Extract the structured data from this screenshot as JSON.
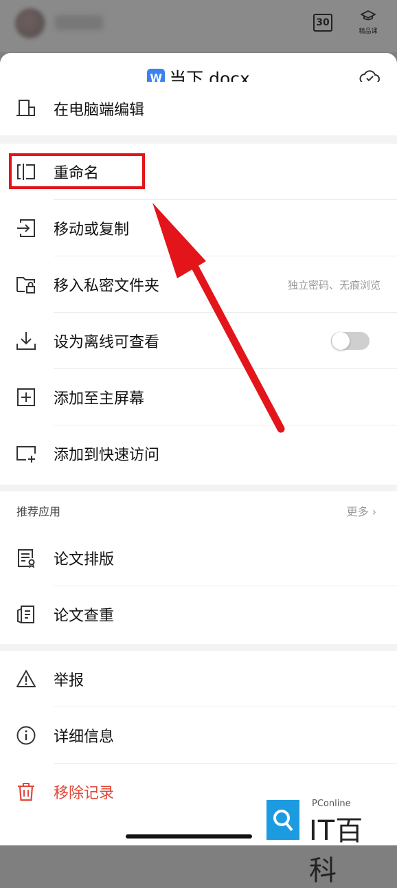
{
  "topbar": {
    "calendar_number": "30",
    "course_label": "精品课"
  },
  "sheet": {
    "doc_icon_letter": "W",
    "title": "当下.docx"
  },
  "menu_group_1": [
    {
      "label": "在电脑端编辑",
      "icon": "desktop-edit-icon"
    }
  ],
  "menu_group_2": [
    {
      "label": "重命名",
      "icon": "rename-icon"
    },
    {
      "label": "移动或复制",
      "icon": "move-icon"
    },
    {
      "label": "移入私密文件夹",
      "icon": "private-folder-icon",
      "hint": "独立密码、无痕浏览"
    },
    {
      "label": "设为离线可查看",
      "icon": "download-icon",
      "toggle_on": false
    },
    {
      "label": "添加至主屏幕",
      "icon": "add-square-icon"
    },
    {
      "label": "添加到快速访问",
      "icon": "quick-access-icon"
    }
  ],
  "recommended": {
    "title": "推荐应用",
    "more": "更多 ›",
    "items": [
      {
        "label": "论文排版",
        "icon": "paper-layout-icon"
      },
      {
        "label": "论文查重",
        "icon": "paper-check-icon"
      }
    ]
  },
  "menu_group_3": [
    {
      "label": "举报",
      "icon": "warning-icon"
    },
    {
      "label": "详细信息",
      "icon": "info-icon"
    },
    {
      "label": "移除记录",
      "icon": "trash-icon"
    }
  ],
  "watermark": {
    "brand": "PConline",
    "site": "IT百科"
  },
  "colors": {
    "highlight": "#e3151a",
    "danger": "#e0493b",
    "doc_blue": "#3b82f0"
  }
}
